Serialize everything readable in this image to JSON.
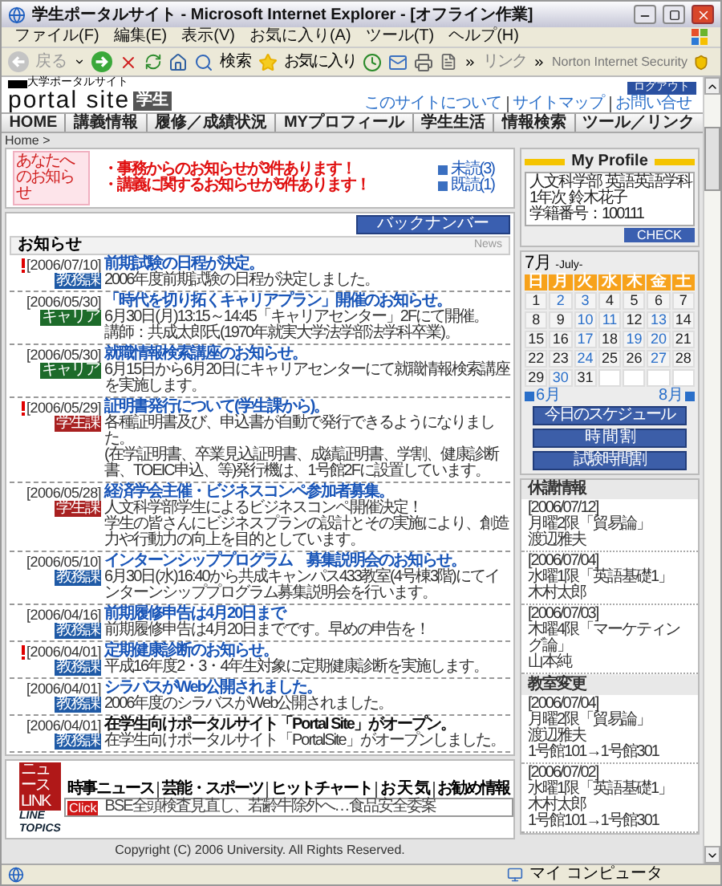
{
  "window": {
    "title": "学生ポータルサイト - Microsoft Internet Explorer - [オフライン作業]"
  },
  "menu": [
    "ファイル(F)",
    "編集(E)",
    "表示(V)",
    "お気に入り(A)",
    "ツール(T)",
    "ヘルプ(H)"
  ],
  "toolbar": {
    "back": "戻る",
    "search": "検索",
    "favorites": "お気に入り",
    "links": "リンク",
    "security": "Norton Internet Security"
  },
  "header": {
    "site_name": "大学ポータルサイト",
    "logo_text": "portal site",
    "logo_badge": "学生",
    "logout": "ログアウト",
    "links": [
      "このサイトについて",
      "サイトマップ",
      "お問い合せ"
    ]
  },
  "nav": [
    "HOME",
    "講義情報",
    "履修／成績状況",
    "MYプロフィール",
    "学生生活",
    "情報検索",
    "ツール／リンク"
  ],
  "breadcrumb": "Home >",
  "notice": {
    "label": "あなたへのお知らせ",
    "messages": [
      "・事務からのお知らせが3件あります！",
      "・講義に関するお知らせが5件あります！"
    ],
    "links": [
      "未読(3)",
      "既読(1)"
    ]
  },
  "news": {
    "back_number": "バックナンバー",
    "heading": "お知らせ",
    "heading_en": "News",
    "items": [
      {
        "date": "[2006/07/10]",
        "important": true,
        "category": "教務課",
        "color": "#1f5aa6",
        "title": "前期試験の日程が決定。",
        "read": false,
        "body": [
          "2006年度前期試験の日程が決定しました。"
        ]
      },
      {
        "date": "[2006/05/30]",
        "important": false,
        "category": "キャリア",
        "color": "#1d6b2a",
        "title": "「時代を切り拓くキャリアプラン」開催のお知らせ。",
        "read": false,
        "body": [
          "6月30日(月)13:15～14:45「キャリアセンター」2Fにて開催。",
          "講師：共成太郎氏(1970年就実大学法学部法学科卒業)。"
        ]
      },
      {
        "date": "[2006/05/30]",
        "important": false,
        "category": "キャリア",
        "color": "#1d6b2a",
        "title": "就職情報検索講座のお知らせ。",
        "read": false,
        "body": [
          "6月15日から6月20日にキャリアセンターにて就職情報検索講座を実施します。"
        ]
      },
      {
        "date": "[2006/05/29]",
        "important": true,
        "category": "学生課",
        "color": "#a82020",
        "title": "証明書発行について(学生課から)。",
        "read": false,
        "body": [
          "各種証明書及び、申込書が自動で発行できるようになりました。",
          "(在学証明書、卒業見込証明書、成績証明書、学割、健康診断書、TOEIC申込、等)発行機は、1号館2Fに設置しています。"
        ]
      },
      {
        "date": "[2006/05/28]",
        "important": false,
        "category": "学生課",
        "color": "#a82020",
        "title": "経済学会主催・ビジネスコンペ参加者募集。",
        "read": false,
        "body": [
          "人文科学部学生によるビジネスコンペ開催決定！",
          "学生の皆さんにビジネスプランの設計とその実施により、創造力や行動力の向上を目的としています。"
        ]
      },
      {
        "date": "[2006/05/10]",
        "important": false,
        "category": "教務課",
        "color": "#1f5aa6",
        "title": "インターンシッププログラム　募集説明会のお知らせ。",
        "read": false,
        "body": [
          "6月30日(水)16:40から共成キャンパス433教室(4号棟3階)にてインターンシッププログラム募集説明会を行います。"
        ]
      },
      {
        "date": "[2006/04/16]",
        "important": false,
        "category": "教務課",
        "color": "#1f5aa6",
        "title": "前期履修申告は4月20日まで",
        "read": false,
        "body": [
          "前期履修申告は4月20日までです。早めの申告を！"
        ]
      },
      {
        "date": "[2006/04/01]",
        "important": true,
        "category": "教務課",
        "color": "#1f5aa6",
        "title": "定期健康診断のお知らせ。",
        "read": false,
        "body": [
          "平成16年度2・3・4年生対象に定期健康診断を実施します。"
        ]
      },
      {
        "date": "[2006/04/01]",
        "important": false,
        "category": "教務課",
        "color": "#1f5aa6",
        "title": "シラバスがWeb公開されました。",
        "read": false,
        "body": [
          "2006年度のシラバスがWeb公開されました。"
        ]
      },
      {
        "date": "[2006/04/01]",
        "important": false,
        "category": "教務課",
        "color": "#1f5aa6",
        "title": "在学生向けポータルサイト「Portal Site」がオープン。",
        "read": true,
        "body": [
          "在学生向けポータルサイト「PortalSite」がオープンしました。"
        ]
      }
    ]
  },
  "ticker": {
    "brand": "ニュースLINK",
    "brand_sub": "LINE TOPICS",
    "tabs": [
      "時事ニュース",
      "芸能・スポーツ",
      "ヒットチャート",
      "お 天 気",
      "お勧め情報"
    ],
    "click": "Click",
    "headline": "BSE全頭検査見直し、若齢牛除外へ…食品安全委案"
  },
  "copyright": "Copyright (C) 2006 University. All Rights Reserved.",
  "profile": {
    "title": "My Profile",
    "lines": [
      "人文科学部 英語英語学科",
      "1年次 鈴木花子",
      "学籍番号：100111"
    ],
    "check": "CHECK"
  },
  "calendar": {
    "month": "7月",
    "month_en": "-July-",
    "weekdays": [
      "日",
      "月",
      "火",
      "水",
      "木",
      "金",
      "土"
    ],
    "days": [
      {
        "day": "1",
        "marked": false
      },
      {
        "day": "2",
        "marked": true
      },
      {
        "day": "3",
        "marked": true
      },
      {
        "day": "4",
        "marked": false
      },
      {
        "day": "5",
        "marked": false
      },
      {
        "day": "6",
        "marked": false
      },
      {
        "day": "7",
        "marked": false
      },
      {
        "day": "8",
        "marked": false
      },
      {
        "day": "9",
        "marked": false
      },
      {
        "day": "10",
        "marked": true
      },
      {
        "day": "11",
        "marked": true
      },
      {
        "day": "12",
        "marked": false
      },
      {
        "day": "13",
        "marked": true
      },
      {
        "day": "14",
        "marked": false
      },
      {
        "day": "15",
        "marked": false
      },
      {
        "day": "16",
        "marked": false
      },
      {
        "day": "17",
        "marked": true
      },
      {
        "day": "18",
        "marked": false
      },
      {
        "day": "19",
        "marked": true
      },
      {
        "day": "20",
        "marked": true
      },
      {
        "day": "21",
        "marked": false
      },
      {
        "day": "22",
        "marked": false
      },
      {
        "day": "23",
        "marked": false
      },
      {
        "day": "24",
        "marked": true
      },
      {
        "day": "25",
        "marked": false
      },
      {
        "day": "26",
        "marked": false
      },
      {
        "day": "27",
        "marked": true
      },
      {
        "day": "28",
        "marked": false
      },
      {
        "day": "29",
        "marked": false
      },
      {
        "day": "30",
        "marked": true
      },
      {
        "day": "31",
        "marked": false
      }
    ],
    "prev": "6月",
    "next": "8月"
  },
  "schedule_buttons": [
    "今日のスケジュール",
    "時 間 割",
    "試験時間割"
  ],
  "cancellations": {
    "title": "休講情報",
    "entries": [
      {
        "lines": [
          "[2006/07/12]",
          "月曜2限「貿易論」",
          "渡辺雅夫"
        ]
      },
      {
        "lines": [
          "[2006/07/04]",
          "水曜1限「英語基礎1」",
          "木村太郎"
        ]
      },
      {
        "lines": [
          "[2006/07/03]",
          "木曜4限「マーケティング論」",
          "山本純"
        ]
      }
    ]
  },
  "room_changes": {
    "title": "教室変更",
    "entries": [
      {
        "lines": [
          "[2006/07/04]",
          "月曜2限「貿易論」",
          "渡辺雅夫",
          "1号館101→1号館301"
        ]
      },
      {
        "lines": [
          "[2006/07/02]",
          "水曜1限「英語基礎1」",
          "木村太郎",
          "1号館101→1号館301"
        ]
      }
    ]
  },
  "status_bar": {
    "zone": "マイ コンピュータ"
  }
}
